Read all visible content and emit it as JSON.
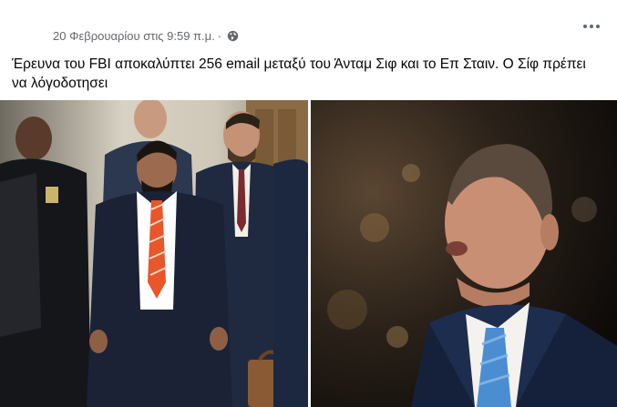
{
  "post": {
    "timestamp": "20 Φεβρουαρίου στις 9:59 π.μ.",
    "separator": "·",
    "audience_icon": "globe-icon",
    "more_icon": "more-options-icon",
    "text": "Έρευνα του FBI αποκαλύπτει 256 email μεταξύ του Άνταμ Σιφ και το Επ Σταιν. Ο Σίφ πρέπει να λόγοδοτησει"
  },
  "images": [
    {
      "name": "photo-left"
    },
    {
      "name": "photo-right"
    }
  ],
  "colors": {
    "meta_text": "#65676b",
    "body_text": "#050505",
    "orange_tie": "#e8562a",
    "blue_tie": "#4a8ed1"
  }
}
